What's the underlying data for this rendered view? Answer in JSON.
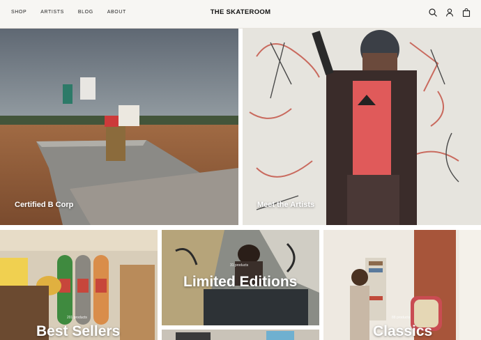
{
  "header": {
    "nav": [
      "SHOP",
      "ARTISTS",
      "BLOG",
      "ABOUT"
    ],
    "brand": "THE SKATEROOM",
    "icons": [
      "search-icon",
      "account-icon",
      "cart-icon"
    ]
  },
  "tiles": {
    "certified": {
      "label": "Certified B Corp"
    },
    "artists": {
      "label": "Meet the Artists"
    },
    "best_sellers": {
      "label": "Best Sellers",
      "count": "201 products"
    },
    "limited": {
      "label": "Limited Editions",
      "count": "31 products"
    },
    "classics": {
      "label": "Classics",
      "count": "88 products"
    }
  },
  "colors": {
    "header_bg": "#f7f6f3",
    "text": "#111111"
  }
}
